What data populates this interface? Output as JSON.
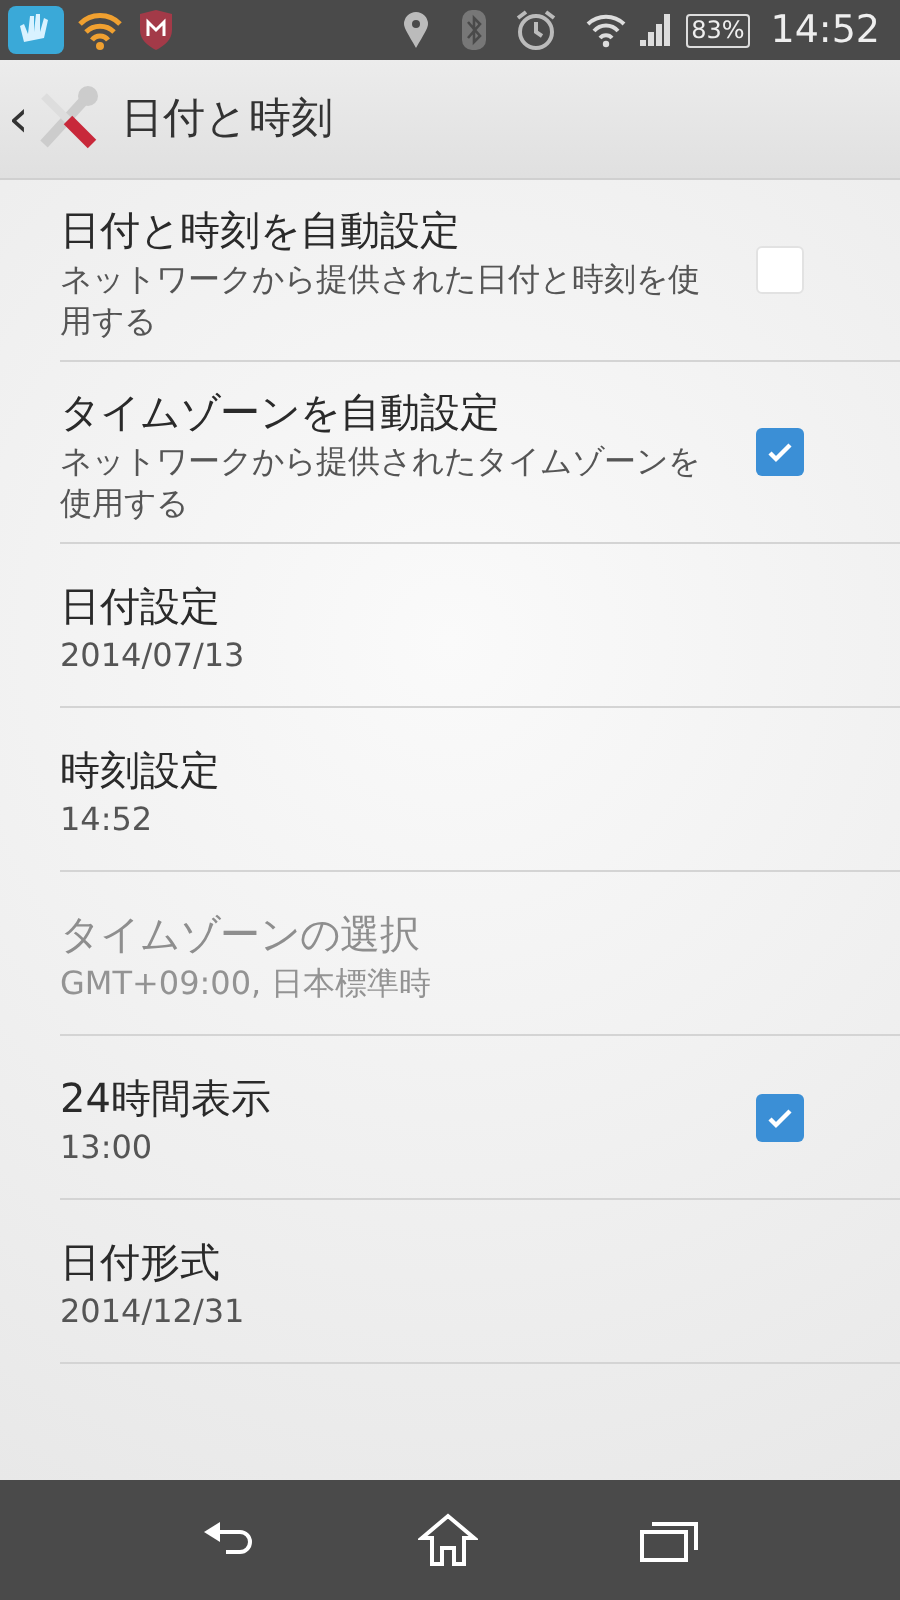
{
  "status_bar": {
    "battery": "83%",
    "time": "14:52"
  },
  "action_bar": {
    "back": "‹",
    "title": "日付と時刻"
  },
  "settings": [
    {
      "kind": "checkbox",
      "title": "日付と時刻を自動設定",
      "summary": "ネットワークから提供された日付と時刻を使用する",
      "checked": false,
      "disabled": false
    },
    {
      "kind": "checkbox",
      "title": "タイムゾーンを自動設定",
      "summary": "ネットワークから提供されたタイムゾーンを使用する",
      "checked": true,
      "disabled": false
    },
    {
      "kind": "plain",
      "title": "日付設定",
      "summary": "2014/07/13",
      "disabled": false
    },
    {
      "kind": "plain",
      "title": "時刻設定",
      "summary": "14:52",
      "disabled": false
    },
    {
      "kind": "plain",
      "title": "タイムゾーンの選択",
      "summary": "GMT+09:00, 日本標準時",
      "disabled": true
    },
    {
      "kind": "checkbox",
      "title": "24時間表示",
      "summary": "13:00",
      "checked": true,
      "disabled": false
    },
    {
      "kind": "plain",
      "title": "日付形式",
      "summary": "2014/12/31",
      "disabled": false
    }
  ]
}
